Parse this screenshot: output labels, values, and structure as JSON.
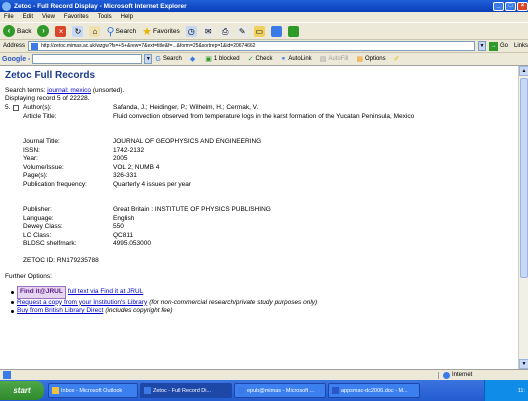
{
  "window": {
    "title": "Zetoc - Full Record Display - Microsoft Internet Explorer",
    "minimize": "_",
    "maximize": "□",
    "close": "×"
  },
  "menu": [
    "File",
    "Edit",
    "View",
    "Favorites",
    "Tools",
    "Help"
  ],
  "toolbar": {
    "back_label": "Back",
    "search_label": "Search",
    "favorites_label": "Favorites"
  },
  "address": {
    "label": "Address",
    "url": "http://zetoc.mimas.ac.uk/wzgw?fs=+5+&rew=7&ext=title&f=...&form=25&sortrep=1&id=20674662",
    "go_label": "Go",
    "links_label": "Links"
  },
  "googlebar": {
    "logo": "Google -",
    "search_label": "Search",
    "blocked_label": "1 blocked",
    "check_label": "Check",
    "autolink_label": "AutoLink",
    "autofill_label": "AutoFill",
    "options_label": "Options"
  },
  "page": {
    "heading": "Zetoc Full Records",
    "search_terms_prefix": "Search terms:",
    "search_terms_link": "journal: mexico",
    "search_terms_suffix": "(unsorted).",
    "displaying": "Displaying record 5 of 22228.",
    "record_number": "5.",
    "fields_a": [
      {
        "label": "Author(s):",
        "value": "Safanda, J.; Heidinger, P.; Wilhelm, H.; Cermak, V."
      },
      {
        "label": "Article Title:",
        "value": "Fluid convection observed from temperature logs in the karst formation of the Yucatan Peninsula, Mexico"
      }
    ],
    "fields_b": [
      {
        "label": "Journal Title:",
        "value": "JOURNAL OF GEOPHYSICS AND ENGINEERING"
      },
      {
        "label": "ISSN:",
        "value": "1742-2132"
      },
      {
        "label": "Year:",
        "value": "2005"
      },
      {
        "label": "Volume/Issue:",
        "value": "VOL 2; NUMB 4"
      },
      {
        "label": "Page(s):",
        "value": "326-331"
      },
      {
        "label": "Publication frequency:",
        "value": "Quarterly 4 issues per year"
      }
    ],
    "fields_c": [
      {
        "label": "Publisher:",
        "value": "Great Britain : INSTITUTE OF PHYSICS PUBLISHING"
      },
      {
        "label": "Language:",
        "value": "English"
      },
      {
        "label": "Dewey Class:",
        "value": "550"
      },
      {
        "label": "LC Class:",
        "value": "QC811"
      },
      {
        "label": "BLDSC shelfmark:",
        "value": "4995.053000"
      }
    ],
    "zetoc_id": "ZETOC ID: RN179235788",
    "further_options": "Further Options:",
    "options": {
      "findit_badge": "Find it@JRUL",
      "findit_link": "full text via Find it at JRUL",
      "request_link": "Request a copy from your Institution's Library",
      "request_note": "(for non-commercial research/private study purposes only)",
      "buy_link": "Buy from British Library Direct",
      "buy_note": "(includes copyright fee)"
    }
  },
  "statusbar": {
    "zone": "Internet"
  },
  "taskbar": {
    "start": "start",
    "tasks": [
      {
        "label": "Inbox - Microsoft Outlook",
        "active": false
      },
      {
        "label": "Zetoc - Full Record Di...",
        "active": true
      },
      {
        "label": "epub@mimas - Microsoft ...",
        "active": false
      },
      {
        "label": "appsmac-dc2006.doc - M...",
        "active": false
      }
    ],
    "clock": "11:"
  }
}
